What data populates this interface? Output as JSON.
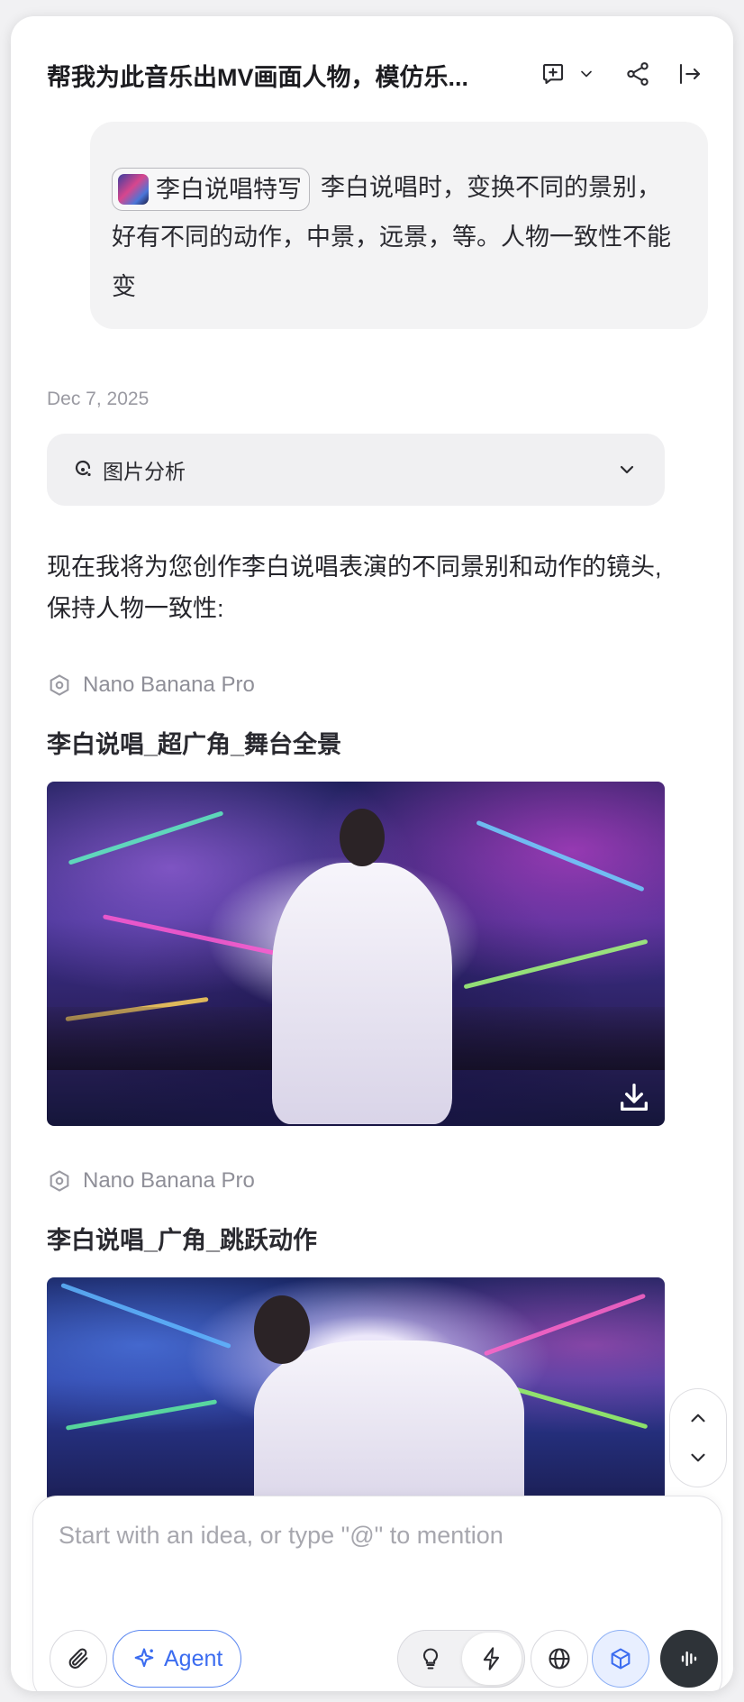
{
  "header": {
    "title": "帮我为此音乐出MV画面人物，模仿乐...",
    "icons": [
      "new-chat-icon",
      "chevron-down-icon",
      "share-icon",
      "collapse-icon"
    ]
  },
  "user_message": {
    "chip_label": "李白说唱特写",
    "text": "李白说唱时，变换不同的景别，好有不同的动作，中景，远景，等。人物一致性不能变"
  },
  "date": "Dec 7, 2025",
  "analysis": {
    "label": "图片分析"
  },
  "assistant": {
    "intro": "现在我将为您创作李白说唱表演的不同景别和动作的镜头,保持人物一致性:",
    "images": [
      {
        "model": "Nano Banana Pro",
        "title": "李白说唱_超广角_舞台全景"
      },
      {
        "model": "Nano Banana Pro",
        "title": "李白说唱_广角_跳跃动作"
      }
    ]
  },
  "composer": {
    "placeholder": "Start with an idea, or type \"@\" to mention",
    "value": "",
    "agent_label": "Agent"
  },
  "colors": {
    "accent": "#3b6cf0",
    "voice_button": "#2e3338",
    "bubble_bg": "#f3f3f4"
  }
}
